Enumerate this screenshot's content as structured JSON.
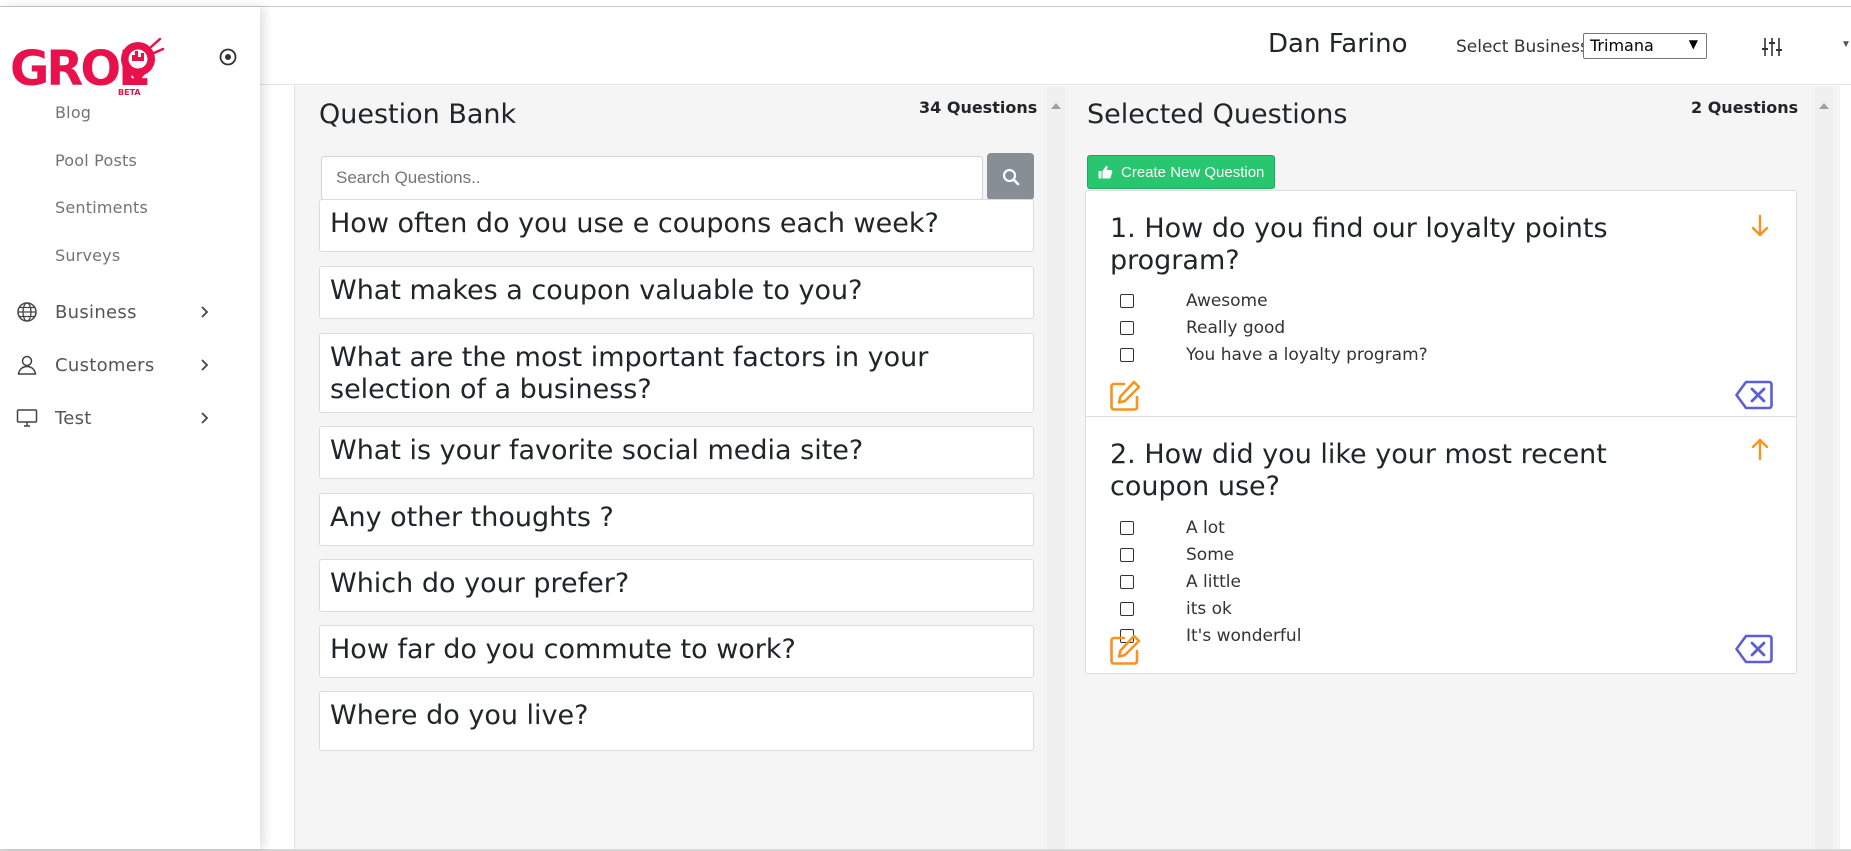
{
  "brand": {
    "logo_text": "GROLO",
    "logo_badge": "BETA",
    "accent_color": "#e8114b"
  },
  "sidebar": {
    "collapse_icon": "target-circle-icon",
    "sub_items": [
      {
        "label": "Blog"
      },
      {
        "label": "Pool Posts"
      },
      {
        "label": "Sentiments"
      },
      {
        "label": "Surveys"
      }
    ],
    "main_items": [
      {
        "label": "Business",
        "icon": "globe-icon"
      },
      {
        "label": "Customers",
        "icon": "user-icon"
      },
      {
        "label": "Test",
        "icon": "monitor-icon"
      }
    ]
  },
  "header": {
    "user_name": "Dan Farino",
    "select_business_label": "Select Business",
    "select_business_value": "Trimana",
    "filter_icon": "sliders-icon"
  },
  "question_bank": {
    "title": "Question Bank",
    "count": "34 Questions",
    "search_placeholder": "Search Questions..",
    "questions": [
      "How often do you use e coupons each week?",
      "What makes a coupon valuable to you?",
      "What are the most important factors in your selection of a business?",
      "What is your favorite social media site?",
      "Any other thoughts ?",
      "Which do your prefer?",
      "How far do you commute to work?",
      "Where do you live?"
    ]
  },
  "selected": {
    "title": "Selected Questions",
    "count": "2 Questions",
    "create_button": "Create New Question",
    "create_color": "#28c76f",
    "action_colors": {
      "edit": "#f7931e",
      "delete": "#5b5fd6",
      "move": "#f7931e"
    },
    "items": [
      {
        "title": "1. How do you find our loyalty points program?",
        "move": "down",
        "options": [
          "Awesome",
          "Really good",
          "You have a loyalty program?"
        ]
      },
      {
        "title": "2. How did you like your most recent coupon use?",
        "move": "up",
        "options": [
          "A lot",
          "Some",
          "A little",
          "its ok",
          "It's wonderful"
        ]
      }
    ]
  }
}
